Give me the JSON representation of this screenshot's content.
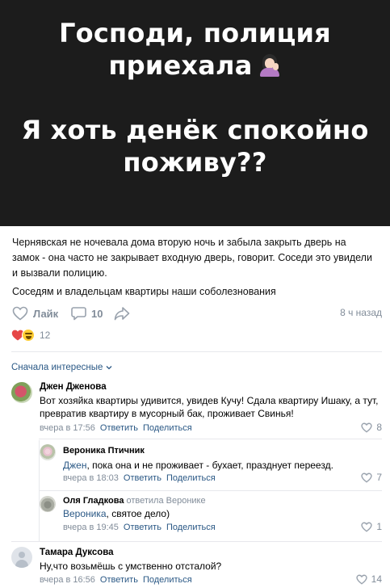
{
  "hero": {
    "line1": "Господи, полиция",
    "line2": "приехала",
    "line2_emoji": "person-facepalming-emoji",
    "line3": "Я хоть денёк спокойно",
    "line4": "поживу??"
  },
  "post": {
    "paragraph1_line1": "Чернявская не ночевала дома вторую ночь и забыла закрыть дверь на",
    "paragraph1_line2": "замок - она часто не закрывает входную дверь, говорит. Соседи это увидели",
    "paragraph1_line3": "и вызвали полицию.",
    "paragraph2": "Соседям и владельцам квартиры наши соболезнования"
  },
  "actions": {
    "like_label": "Лайк",
    "comments_count": "10",
    "time_ago": "8 ч назад"
  },
  "reactions": {
    "icons": [
      "heart",
      "laughing-face"
    ],
    "count": "12"
  },
  "comments_sort": {
    "label": "Сначала интересные"
  },
  "comments": [
    {
      "author": "Джен Дженова",
      "text_line1": "Вот хозяйка квартиры удивится, увидев Кучу! Сдала квартиру Ишаку, а тут,",
      "text_line2": "превратив квартиру в мусорный бак, проживает Свинья!",
      "time": "вчера в 17:56",
      "reply_label": "Ответить",
      "share_label": "Поделиться",
      "likes": "8"
    },
    {
      "author": "Вероника Птичник",
      "mention": "Джен",
      "text": ", пока она и не проживает - бухает, празднует переезд.",
      "time": "вчера в 18:03",
      "reply_label": "Ответить",
      "share_label": "Поделиться",
      "likes": "7"
    },
    {
      "author": "Оля Гладкова",
      "reply_note": "ответила Веронике",
      "mention": "Вероника",
      "text": ", святое дело)",
      "time": "вчера в 19:45",
      "reply_label": "Ответить",
      "share_label": "Поделиться",
      "likes": "1"
    },
    {
      "author": "Тамара Дуксова",
      "text": "Ну,что возьмёшь с умственно отсталой?",
      "time": "вчера в 16:56",
      "reply_label": "Ответить",
      "share_label": "Поделиться",
      "likes": "14"
    }
  ],
  "colors": {
    "hero_bg": "#1c1c1c",
    "link": "#2a5885",
    "muted": "#818c99",
    "heart": "#e64646"
  }
}
